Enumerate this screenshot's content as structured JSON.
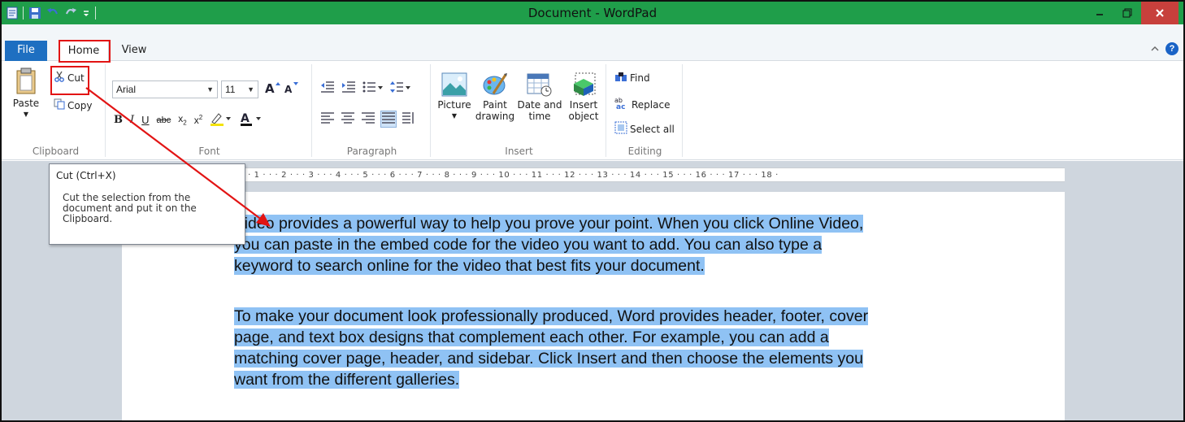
{
  "window": {
    "title": "Document - WordPad"
  },
  "tabs": {
    "file": "File",
    "home": "Home",
    "view": "View"
  },
  "clipboard": {
    "paste": "Paste",
    "cut": "Cut",
    "copy": "Copy",
    "group_label": "Clipboard"
  },
  "font": {
    "family": "Arial",
    "size": "11",
    "group_label": "Font"
  },
  "paragraph": {
    "group_label": "Paragraph"
  },
  "insert": {
    "picture": "Picture",
    "paint_drawing_1": "Paint",
    "paint_drawing_2": "drawing",
    "date_time_1": "Date and",
    "date_time_2": "time",
    "insert_object_1": "Insert",
    "insert_object_2": "object",
    "group_label": "Insert"
  },
  "editing": {
    "find": "Find",
    "replace": "Replace",
    "select_all": "Select all",
    "group_label": "Editing"
  },
  "ruler": {
    "ticks": "· · · 1 · · · 2 · · · 3 · · · 4 · · · 5 · · · 6 · · · 7 · · · 8 · · · 9 · · · 10 · · · 11 · · · 12 · · · 13 · · · 14 · · · 15 · · · 16 · · · 17 · · · 18 ·"
  },
  "tooltip": {
    "title": "Cut (Ctrl+X)",
    "body_1": "Cut the selection from the",
    "body_2": "document and put it on the",
    "body_3": "Clipboard."
  },
  "document": {
    "p1_l1": "Video provides a powerful way to help you prove your point. When you click Online Video,",
    "p1_l2": "you can paste in the embed code for the video you want to add. You can also type a",
    "p1_l3": "keyword to search online for the video that best fits your document.",
    "p2_l1": "To make your document look professionally produced, Word provides header, footer, cover",
    "p2_l2": "page, and text box designs that complement each other. For example, you can add a",
    "p2_l3": "matching cover page, header, and sidebar. Click Insert and then choose the elements you",
    "p2_l4": "want from the different galleries."
  },
  "colors": {
    "titlebar": "#1f9e4a",
    "file_tab": "#1e6fc1",
    "selection": "#8fc2f4",
    "annotation": "#e21414"
  }
}
